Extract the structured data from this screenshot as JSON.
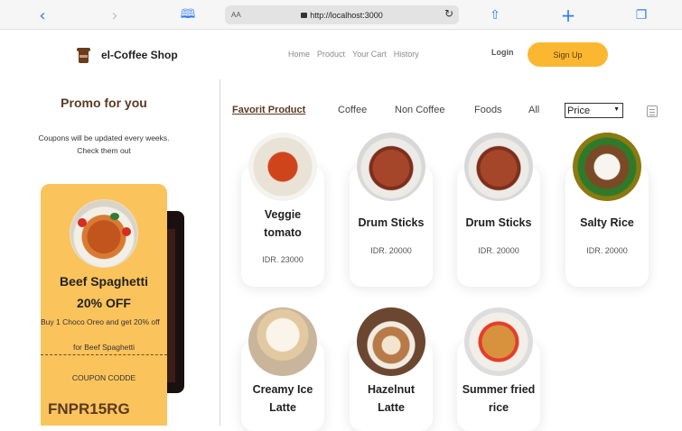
{
  "browser": {
    "aa_label": "AA",
    "url": "http://localhost:3000"
  },
  "header": {
    "brand": "el-Coffee Shop",
    "nav": [
      "Home",
      "Product",
      "Your Cart",
      "History"
    ],
    "login_label": "Login",
    "signup_label": "Sign Up"
  },
  "promo": {
    "title": "Promo for you",
    "subtitle_line1": "Coupons will be updated every weeks.",
    "subtitle_line2": "Check them out",
    "coupon": {
      "name": "Beef Spaghetti",
      "discount": "20% OFF",
      "description": "Buy 1 Choco Oreo and get 20% off",
      "for_text": "for Beef Spaghetti",
      "code_label": "COUPON CODDE",
      "code": "FNPR15RG"
    }
  },
  "categories": {
    "tabs": [
      "Favorit Product",
      "Coffee",
      "Non Coffee",
      "Foods",
      "All"
    ],
    "active": "Favorit Product",
    "sort_selected": "Price"
  },
  "products": [
    {
      "name_line1": "Veggie",
      "name_line2": "tomato",
      "price": "IDR. 23000",
      "icon": "veggie-tomato-image"
    },
    {
      "name_line1": "Drum Sticks",
      "name_line2": "",
      "price": "IDR. 20000",
      "icon": "drum-sticks-image"
    },
    {
      "name_line1": "Drum Sticks",
      "name_line2": "",
      "price": "IDR. 20000",
      "icon": "drum-sticks-image"
    },
    {
      "name_line1": "Salty Rice",
      "name_line2": "",
      "price": "IDR. 20000",
      "icon": "salty-rice-image"
    },
    {
      "name_line1": "Creamy Ice",
      "name_line2": "Latte",
      "price": "",
      "icon": "creamy-ice-latte-image"
    },
    {
      "name_line1": "Hazelnut",
      "name_line2": "Latte",
      "price": "",
      "icon": "hazelnut-latte-image"
    },
    {
      "name_line1": "Summer fried",
      "name_line2": "rice",
      "price": "",
      "icon": "summer-fried-rice-image"
    }
  ],
  "colors": {
    "accent": "#fbb730",
    "coupon_bg": "#fbc35c",
    "brand_brown": "#5a3a22"
  }
}
